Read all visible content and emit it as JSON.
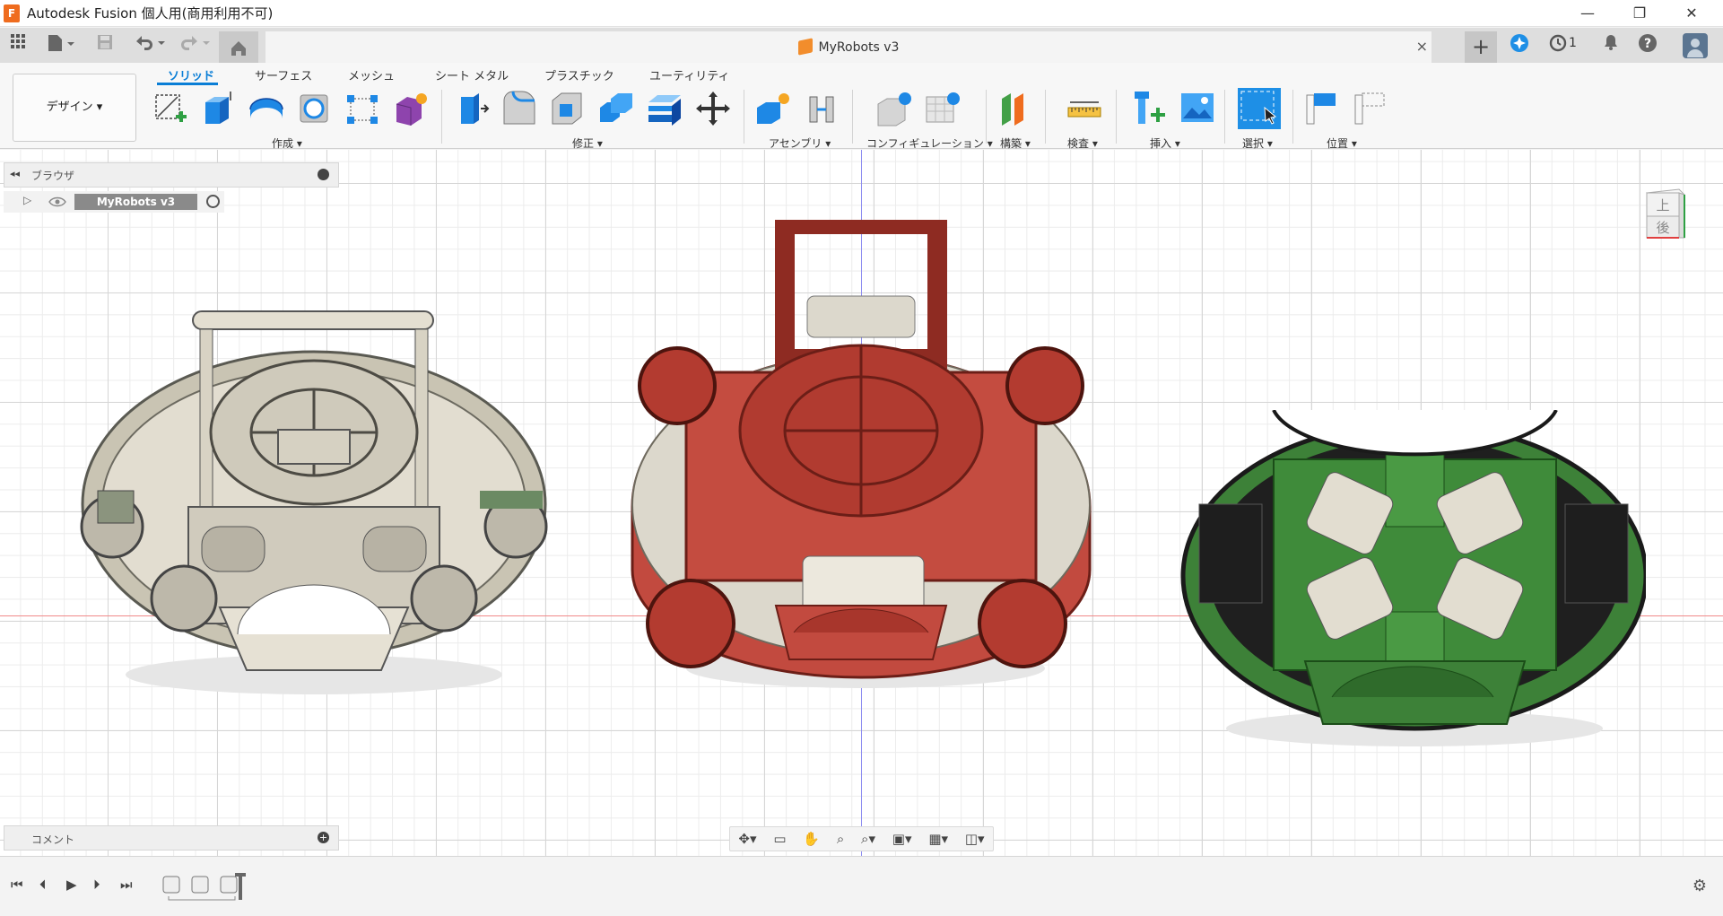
{
  "window": {
    "title": "Autodesk Fusion 個人用(商用利用不可)",
    "minimize": "—",
    "restore": "❐",
    "close": "✕"
  },
  "quick_access": {
    "grid_icon": "grid-icon",
    "file_icon": "file-icon",
    "save_icon": "save-icon",
    "undo_icon": "undo-icon",
    "redo_icon": "redo-icon",
    "home_icon": "home-icon"
  },
  "document_tab": {
    "title": "MyRobots v3",
    "close": "×",
    "new_tab": "+"
  },
  "top_right": {
    "job_count": "1"
  },
  "ribbon": {
    "workspace": "デザイン ▾",
    "tabs": [
      "ソリッド",
      "サーフェス",
      "メッシュ",
      "シート メタル",
      "プラスチック",
      "ユーティリティ"
    ],
    "groups": {
      "create": "作成 ▾",
      "modify": "修正 ▾",
      "assemble": "アセンブリ ▾",
      "configure": "コンフィギュレーション ▾",
      "construct": "構築 ▾",
      "inspect": "検査 ▾",
      "insert": "挿入 ▾",
      "select": "選択 ▾",
      "position": "位置 ▾"
    }
  },
  "browser": {
    "title": "ブラウザ",
    "root": "MyRobots v3"
  },
  "comments": {
    "title": "コメント"
  },
  "viewcube": {
    "top_face": "上",
    "front_face": "後"
  },
  "colors": {
    "accent": "#0a7ed6",
    "robot_gray": "#d8d4c6",
    "robot_red": "#c0463c",
    "robot_green": "#3f8a3c",
    "robot_black": "#1d1d1d"
  }
}
